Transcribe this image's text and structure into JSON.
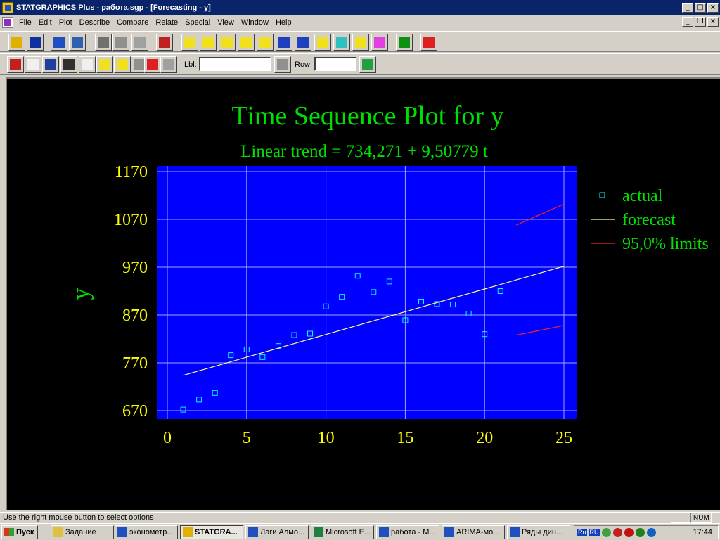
{
  "window": {
    "title": "STATGRAPHICS Plus - работа.sgp - [Forecasting - y]",
    "controls": [
      "_",
      "□",
      "×"
    ],
    "doc_controls": [
      "_",
      "❐",
      "×"
    ]
  },
  "menu": [
    "File",
    "Edit",
    "Plot",
    "Describe",
    "Compare",
    "Relate",
    "Special",
    "View",
    "Window",
    "Help"
  ],
  "toolbar1": [
    {
      "name": "open-icon",
      "color": "#e0b000"
    },
    {
      "name": "save-icon",
      "color": "#1030a0"
    },
    {
      "name": "datasheet-icon",
      "color": "#2050c0"
    },
    {
      "name": "calculator-icon",
      "color": "#3060b0"
    },
    {
      "name": "cut-icon",
      "color": "#707070"
    },
    {
      "name": "copy-icon",
      "color": "#909090"
    },
    {
      "name": "paste-icon",
      "color": "#a0a0a0"
    },
    {
      "name": "print-icon",
      "color": "#c02020"
    },
    {
      "name": "scatterplot-icon",
      "color": "#f0e020"
    },
    {
      "name": "boxplot-icon",
      "color": "#f0e020"
    },
    {
      "name": "histogram-icon",
      "color": "#f0e020"
    },
    {
      "name": "xy-plot-icon",
      "color": "#f0e020"
    },
    {
      "name": "matrix-plot-icon",
      "color": "#f0e020"
    },
    {
      "name": "timeseries-icon",
      "color": "#2040c0"
    },
    {
      "name": "distribution-icon",
      "color": "#2040c0"
    },
    {
      "name": "regression-icon",
      "color": "#f0e020"
    },
    {
      "name": "globe-icon",
      "color": "#30c0c0"
    },
    {
      "name": "tree-icon",
      "color": "#f0e020"
    },
    {
      "name": "quality-icon",
      "color": "#e040e0"
    },
    {
      "name": "statadvisor-icon",
      "color": "#109010"
    },
    {
      "name": "help-icon",
      "color": "#e02020"
    }
  ],
  "toolbar2": [
    {
      "name": "input-dialog-icon",
      "color": "#c02020"
    },
    {
      "name": "analysis-options-icon",
      "color": "#f0f0f0"
    },
    {
      "name": "tabular-options-icon",
      "color": "#2040a0"
    },
    {
      "name": "graphical-options-icon",
      "color": "#303030"
    },
    {
      "name": "save-results-icon",
      "color": "#f0f0f0"
    },
    {
      "name": "exclude-points-icon",
      "color": "#f0e020"
    },
    {
      "name": "pane-options-icon",
      "color": "#f0e020"
    },
    {
      "name": "locate-icon",
      "color": "#909090"
    },
    {
      "name": "dice-icon",
      "color": "#e02020"
    },
    {
      "name": "line-draw-icon",
      "color": "#a0a0a0"
    }
  ],
  "lbl_label": "Lbl:",
  "lbl_value": "",
  "row_label": "Row:",
  "row_value": "",
  "chart_data": {
    "type": "line",
    "title": "Time Sequence Plot for y",
    "subtitle": "Linear trend = 734,271 + 9,50779 t",
    "ylabel": "y",
    "xlim": [
      0,
      25
    ],
    "ylim": [
      660,
      1180
    ],
    "x_ticks": [
      0,
      5,
      10,
      15,
      20,
      25
    ],
    "y_ticks": [
      670,
      770,
      870,
      970,
      1070,
      1170
    ],
    "grid": true,
    "legend_position": "right",
    "series": [
      {
        "name": "actual",
        "type": "scatter",
        "color": "#00ffff",
        "x": [
          1,
          2,
          3,
          4,
          5,
          6,
          7,
          8,
          9,
          10,
          11,
          12,
          13,
          14,
          15,
          16,
          17,
          18,
          19,
          20,
          21
        ],
        "y": [
          672,
          693,
          707,
          786,
          798,
          782,
          805,
          828,
          831,
          888,
          908,
          952,
          918,
          940,
          859,
          898,
          893,
          892,
          873,
          830,
          920
        ]
      },
      {
        "name": "forecast",
        "type": "line",
        "color": "#ffff80",
        "x": [
          1,
          2,
          3,
          4,
          5,
          6,
          7,
          8,
          9,
          10,
          11,
          12,
          13,
          14,
          15,
          16,
          17,
          18,
          19,
          20,
          21,
          22,
          23,
          24,
          25
        ],
        "y": [
          743.8,
          753.3,
          762.8,
          772.3,
          781.8,
          791.3,
          800.8,
          810.3,
          819.8,
          829.3,
          838.9,
          848.4,
          857.9,
          867.4,
          876.9,
          886.4,
          895.9,
          905.4,
          914.9,
          924.4,
          933.9,
          943.4,
          953.0,
          962.5,
          972.0
        ]
      },
      {
        "name": "95,0% limits",
        "type": "line",
        "color": "#ff2020",
        "x": [
          22,
          25
        ],
        "upper": [
          1058,
          1102
        ],
        "lower": [
          828,
          848
        ]
      }
    ]
  },
  "status": {
    "text": "Use the right mouse button to select options",
    "num": "NUM"
  },
  "taskbar": {
    "start": "Пуск",
    "tasks": [
      {
        "label": "Задание",
        "icon": "folder-icon",
        "color": "#e0c040"
      },
      {
        "label": "эконометр...",
        "icon": "word-icon",
        "color": "#2050c0"
      },
      {
        "label": "STATGRA...",
        "icon": "statgraphics-icon",
        "color": "#e0b000",
        "active": true
      },
      {
        "label": "Лаги Алмо...",
        "icon": "word-icon",
        "color": "#2050c0"
      },
      {
        "label": "Microsoft E...",
        "icon": "excel-icon",
        "color": "#208040"
      },
      {
        "label": "работа - М...",
        "icon": "word-icon",
        "color": "#2050c0"
      },
      {
        "label": "ARIMA-мо...",
        "icon": "word-icon",
        "color": "#2050c0"
      },
      {
        "label": "Ряды дин...",
        "icon": "word-icon",
        "color": "#2050c0"
      }
    ],
    "tray_lang": [
      "Ru",
      "RU"
    ],
    "tray_icons": [
      {
        "name": "network-icon",
        "color": "#40a040"
      },
      {
        "name": "antivirus-icon",
        "color": "#c02020"
      },
      {
        "name": "k-icon",
        "color": "#c01010"
      },
      {
        "name": "gear-tray-icon",
        "color": "#208020"
      },
      {
        "name": "globe-tray-icon",
        "color": "#1060c0"
      }
    ],
    "clock": "17:44"
  }
}
